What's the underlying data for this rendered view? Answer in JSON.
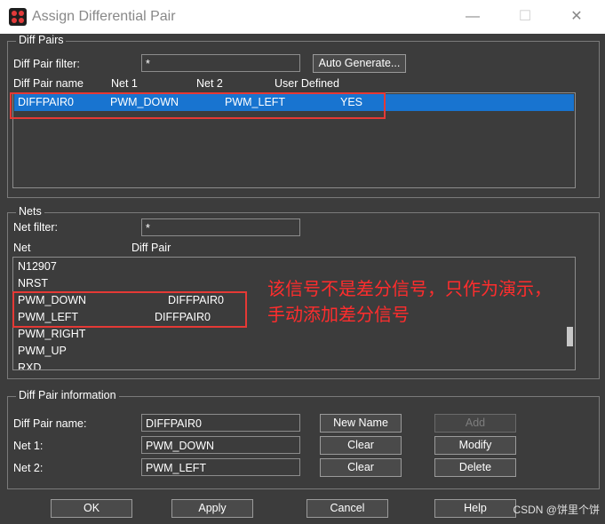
{
  "window": {
    "title": "Assign Differential Pair",
    "minimize": "—",
    "maximize": "☐",
    "close": "✕"
  },
  "diff_pairs": {
    "group_title": "Diff Pairs",
    "filter_label": "Diff Pair filter:",
    "filter_value": "*",
    "auto_generate": "Auto Generate...",
    "columns": [
      "Diff Pair name",
      "Net 1",
      "Net 2",
      "User Defined"
    ],
    "rows": [
      {
        "name": "DIFFPAIR0",
        "net1": "PWM_DOWN",
        "net2": "PWM_LEFT",
        "user_defined": "YES",
        "selected": true
      }
    ]
  },
  "nets": {
    "group_title": "Nets",
    "filter_label": "Net filter:",
    "filter_value": "*",
    "columns": [
      "Net",
      "Diff Pair"
    ],
    "rows": [
      {
        "net": "N12907",
        "pair": ""
      },
      {
        "net": "NRST",
        "pair": ""
      },
      {
        "net": "PWM_DOWN",
        "pair": "DIFFPAIR0"
      },
      {
        "net": "PWM_LEFT",
        "pair": "DIFFPAIR0"
      },
      {
        "net": "PWM_RIGHT",
        "pair": ""
      },
      {
        "net": "PWM_UP",
        "pair": ""
      },
      {
        "net": "RXD",
        "pair": ""
      }
    ]
  },
  "annotation": {
    "line1": "该信号不是差分信号，只作为演示，",
    "line2": "手动添加差分信号"
  },
  "info": {
    "group_title": "Diff Pair information",
    "name_label": "Diff Pair name:",
    "name_value": "DIFFPAIR0",
    "net1_label": "Net 1:",
    "net1_value": "PWM_DOWN",
    "net2_label": "Net 2:",
    "net2_value": "PWM_LEFT",
    "new_name": "New Name",
    "clear1": "Clear",
    "clear2": "Clear",
    "add": "Add",
    "modify": "Modify",
    "delete": "Delete"
  },
  "footer": {
    "ok": "OK",
    "apply": "Apply",
    "cancel": "Cancel",
    "help": "Help"
  },
  "watermark": "CSDN @饼里个饼",
  "colors": {
    "background": "#3c3c3c",
    "selection": "#1874d0",
    "annotation": "#ff2d2d"
  }
}
